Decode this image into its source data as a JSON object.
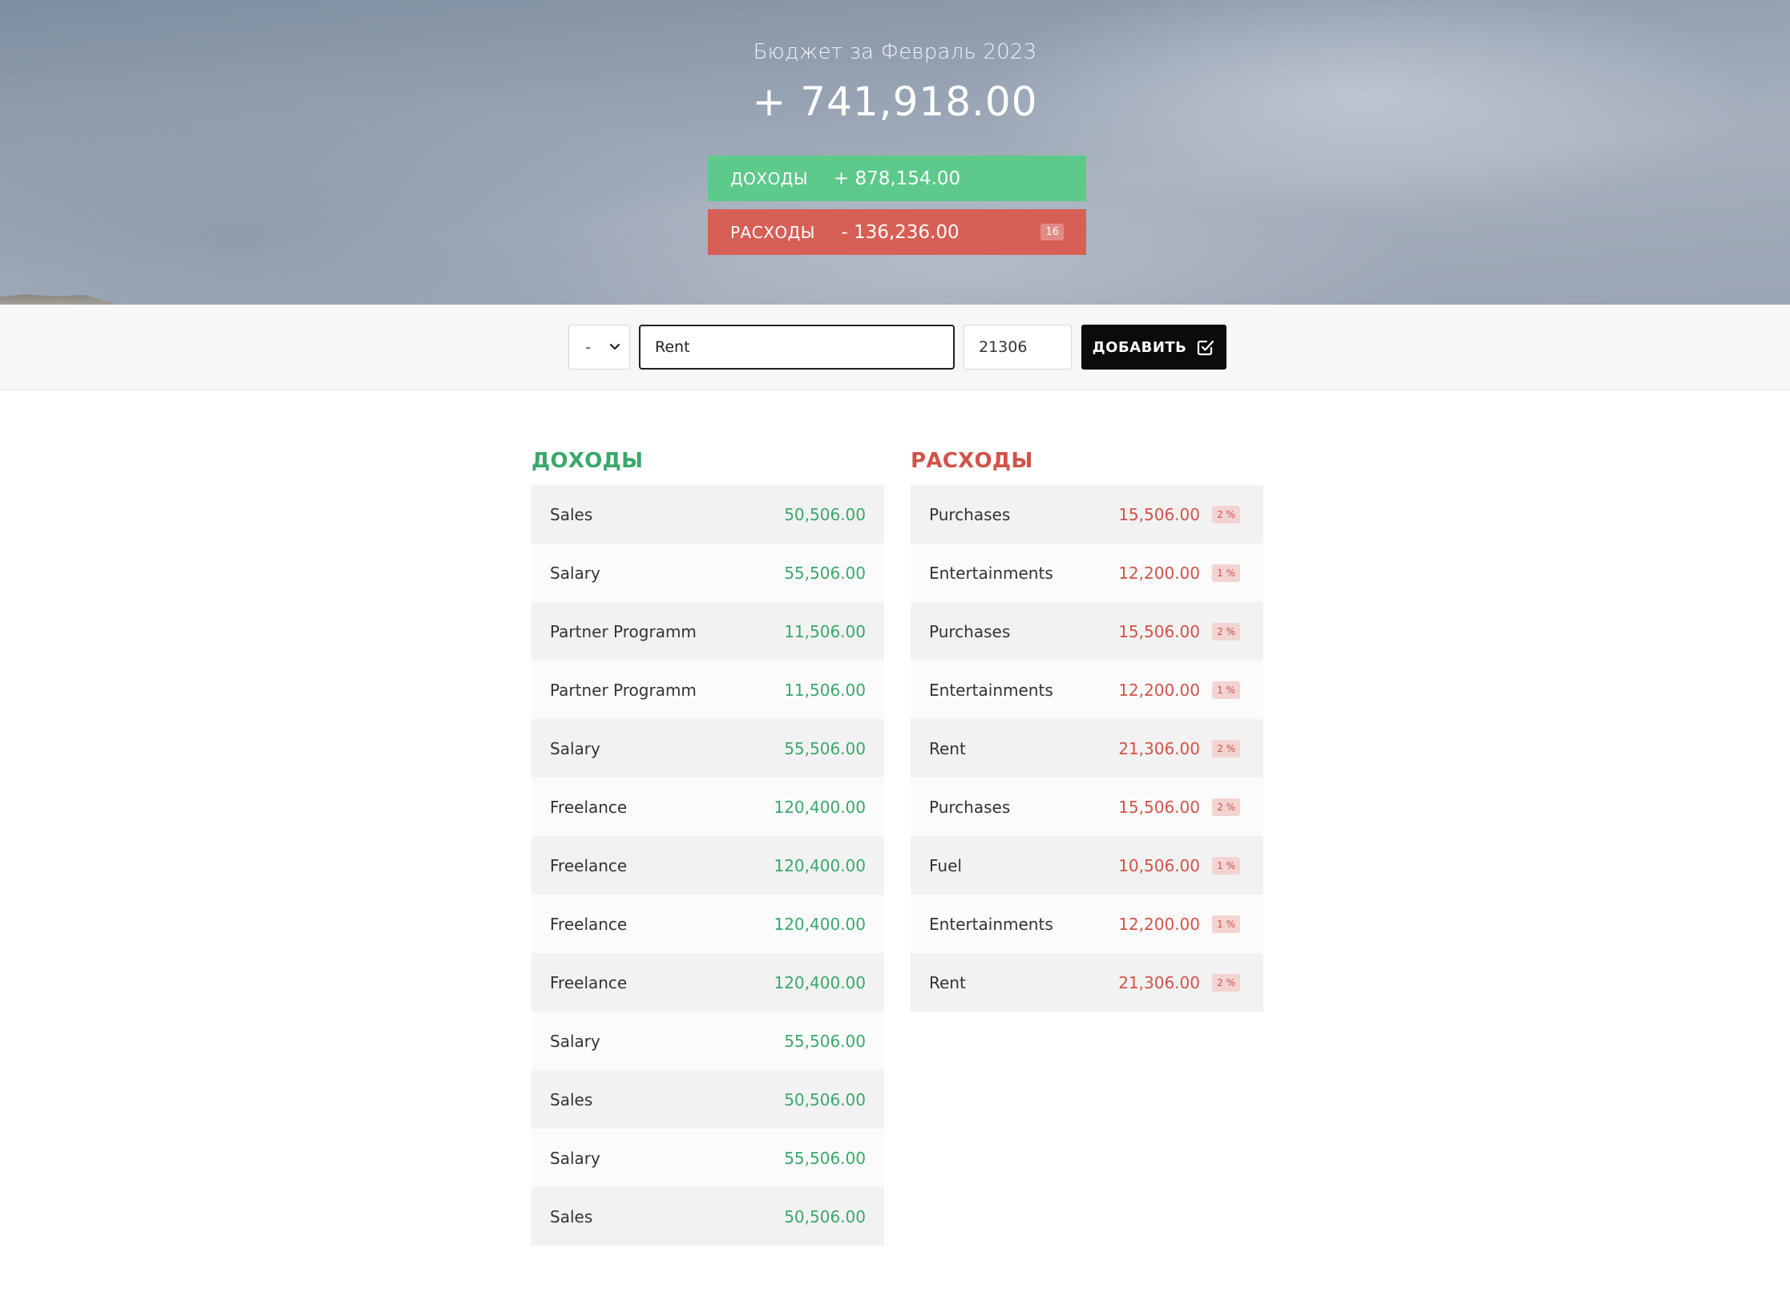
{
  "header": {
    "title": "Бюджет за Февраль 2023",
    "total": "+ 741,918.00",
    "income_label": "Доходы",
    "income_value": "+ 878,154.00",
    "expense_label": "Расходы",
    "expense_value": "- 136,236.00",
    "expense_percent": "16"
  },
  "form": {
    "type_value": "-",
    "description_value": "Rent",
    "value_value": "21306",
    "add_label": "Добавить"
  },
  "income": {
    "title": "Доходы",
    "items": [
      {
        "desc": "Sales",
        "value": "50,506.00"
      },
      {
        "desc": "Salary",
        "value": "55,506.00"
      },
      {
        "desc": "Partner Programm",
        "value": "11,506.00"
      },
      {
        "desc": "Partner Programm",
        "value": "11,506.00"
      },
      {
        "desc": "Salary",
        "value": "55,506.00"
      },
      {
        "desc": "Freelance",
        "value": "120,400.00"
      },
      {
        "desc": "Freelance",
        "value": "120,400.00"
      },
      {
        "desc": "Freelance",
        "value": "120,400.00"
      },
      {
        "desc": "Freelance",
        "value": "120,400.00"
      },
      {
        "desc": "Salary",
        "value": "55,506.00"
      },
      {
        "desc": "Sales",
        "value": "50,506.00"
      },
      {
        "desc": "Salary",
        "value": "55,506.00"
      },
      {
        "desc": "Sales",
        "value": "50,506.00"
      }
    ]
  },
  "expenses": {
    "title": "Расходы",
    "items": [
      {
        "desc": "Purchases",
        "value": "15,506.00",
        "percent": "2 %"
      },
      {
        "desc": "Entertainments",
        "value": "12,200.00",
        "percent": "1 %"
      },
      {
        "desc": "Purchases",
        "value": "15,506.00",
        "percent": "2 %"
      },
      {
        "desc": "Entertainments",
        "value": "12,200.00",
        "percent": "1 %"
      },
      {
        "desc": "Rent",
        "value": "21,306.00",
        "percent": "2 %"
      },
      {
        "desc": "Purchases",
        "value": "15,506.00",
        "percent": "2 %"
      },
      {
        "desc": "Fuel",
        "value": "10,506.00",
        "percent": "1 %"
      },
      {
        "desc": "Entertainments",
        "value": "12,200.00",
        "percent": "1 %"
      },
      {
        "desc": "Rent",
        "value": "21,306.00",
        "percent": "2 %"
      }
    ]
  },
  "colors": {
    "income_accent": "#5dc98a",
    "income_text": "#3aa86b",
    "expense_accent": "#d75f55",
    "expense_text": "#d2524a",
    "button": "#0b0b0b"
  },
  "icons": {
    "select_arrow": "chevron-down-icon",
    "add_button": "checkbox-checked-icon"
  }
}
